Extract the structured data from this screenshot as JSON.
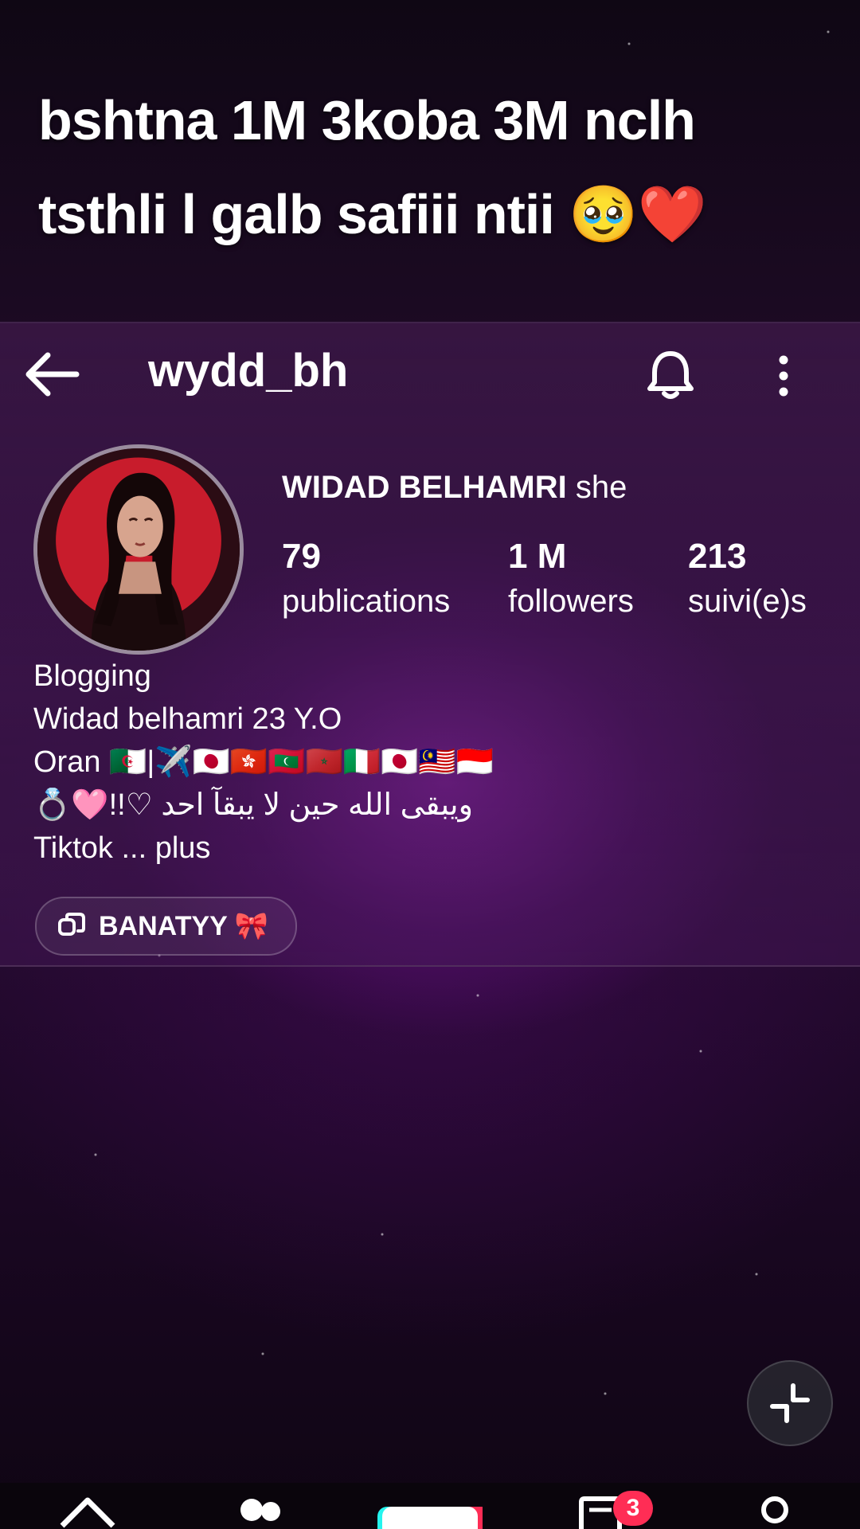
{
  "caption": {
    "line1": "bshtna 1M 3koba 3M nclh",
    "line2": "tsthli l galb safiii ntii",
    "emojis": "🥹❤️"
  },
  "header": {
    "username": "wydd_bh",
    "back_icon": "arrow-left-icon",
    "bell_icon": "bell-icon",
    "more_icon": "vertical-dots-icon"
  },
  "profile": {
    "display_name": "WIDAD BELHAMRI",
    "pronouns": "she",
    "stats": [
      {
        "value": "79",
        "label": "publications"
      },
      {
        "value": "1 M",
        "label": "followers"
      },
      {
        "value": "213",
        "label": "suivi(e)s"
      }
    ],
    "bio": [
      "Blogging",
      "Widad belhamri 23 Y.O",
      " Oran 🇩🇿|✈️🇯🇵🇭🇰🇲🇻🇲🇦🇮🇹🇯🇵🇲🇾🇮🇩",
      "ويبقى الله حين لا يبقآ احد ♡!!🩷💍",
      "Tiktok ... plus"
    ],
    "link_chip": "BANATYY 🎀"
  },
  "bottom_bar": {
    "tabs": [
      "home-icon",
      "friends-icon",
      "create-icon",
      "inbox-icon",
      "profile-icon"
    ],
    "inbox_badge": "3"
  },
  "colors": {
    "accent_badge": "#ff2d55",
    "background_glow": "#aa28c8"
  }
}
